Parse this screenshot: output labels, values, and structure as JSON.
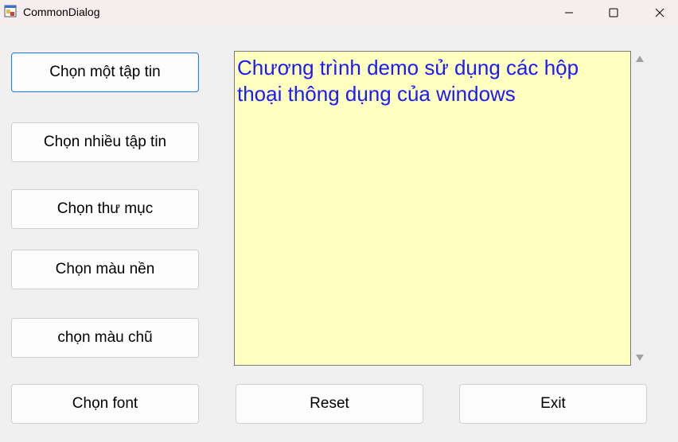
{
  "window": {
    "title": "CommonDialog",
    "controls": {
      "minimize_icon": "minimize-icon",
      "maximize_icon": "maximize-icon",
      "close_icon": "close-icon"
    }
  },
  "buttons": {
    "choose_file": "Chọn một tập tin",
    "choose_files": "Chọn nhiều tập tin",
    "choose_folder": "Chọn thư mục",
    "choose_bg_color": "Chọn màu nền",
    "choose_text_color": "chọn màu chũ",
    "choose_font": "Chọn font",
    "reset": "Reset",
    "exit": "Exit"
  },
  "textbox": {
    "text": "Chương trình demo sử dụng các hộp thoại thông dụng của windows",
    "background": "#ffffc0",
    "color": "#1a1aff"
  }
}
